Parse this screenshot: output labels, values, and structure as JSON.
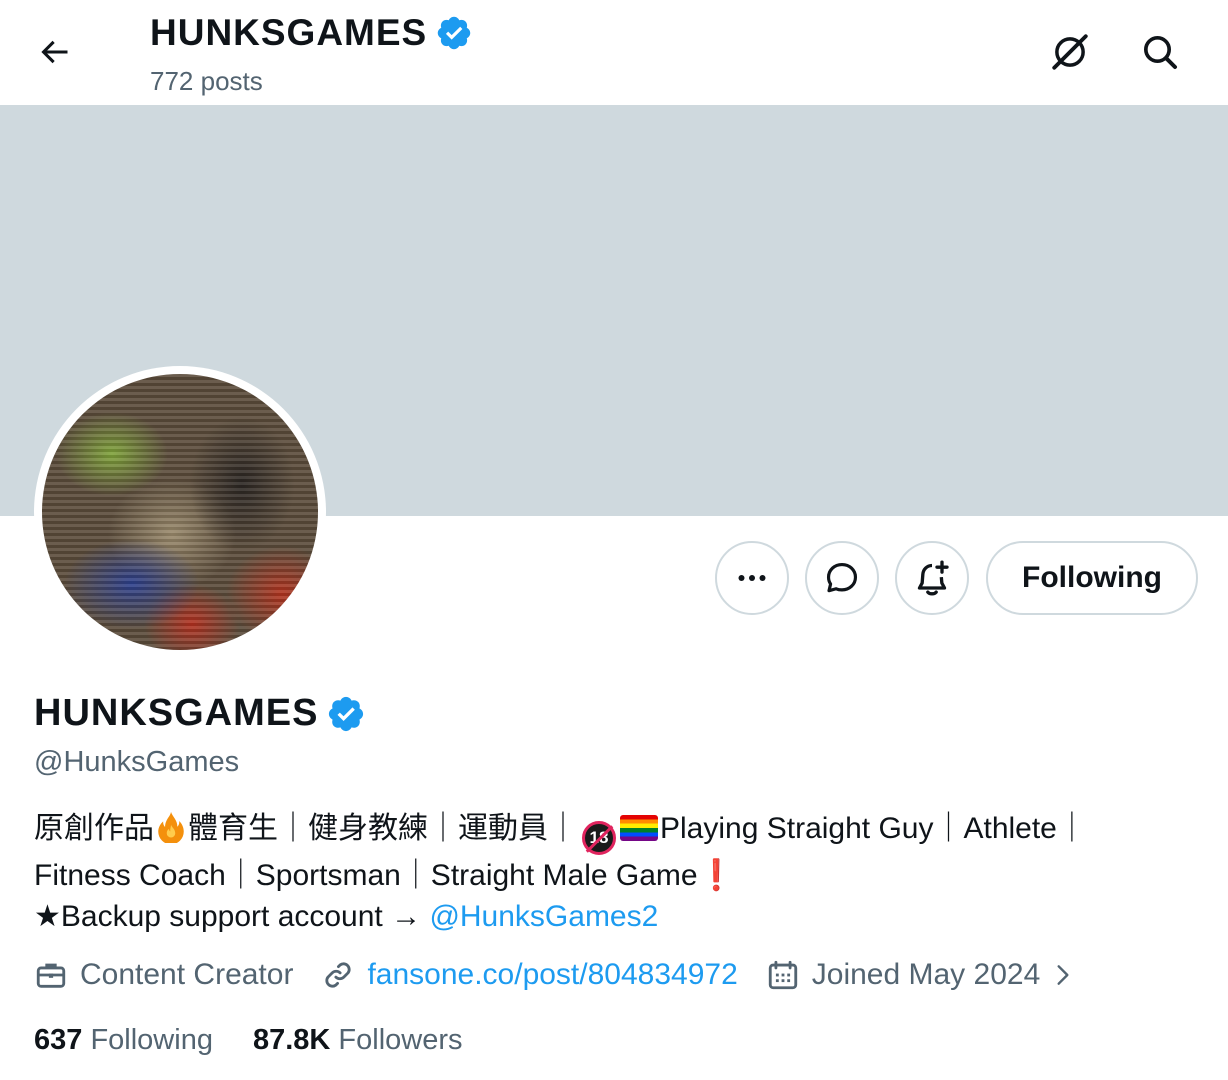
{
  "header": {
    "title": "HUNKSGAMES",
    "posts": "772 posts"
  },
  "profile": {
    "name": "HUNKSGAMES",
    "handle": "@HunksGames",
    "follow_button": "Following"
  },
  "bio": {
    "line1_a": "原創作品",
    "line1_b": "體育生｜健身教練｜運動員｜",
    "line1_c": "Playing Straight Guy｜Athlete｜",
    "line2": "Fitness Coach｜Sportsman｜Straight Male Game",
    "line2_excl": "❗",
    "line3_text": "★Backup support account → ",
    "line3_link": "@HunksGames2",
    "badge": "18"
  },
  "meta": {
    "category": "Content Creator",
    "website": "fansone.co/post/804834972",
    "joined": "Joined May 2024"
  },
  "stats": {
    "following_count": "637",
    "following_label": "Following",
    "followers_count": "87.8K",
    "followers_label": "Followers"
  },
  "icons": {
    "back": "arrow-left-icon",
    "grok": "grok-icon",
    "search": "search-icon",
    "more": "more-icon",
    "message": "message-icon",
    "notify": "bell-plus-icon",
    "verified": "verified-badge-icon",
    "briefcase": "briefcase-icon",
    "link": "link-icon",
    "calendar": "calendar-icon"
  },
  "colors": {
    "accent": "#1d9bf0",
    "banner": "#cfd9de",
    "secondary_text": "#536471"
  }
}
